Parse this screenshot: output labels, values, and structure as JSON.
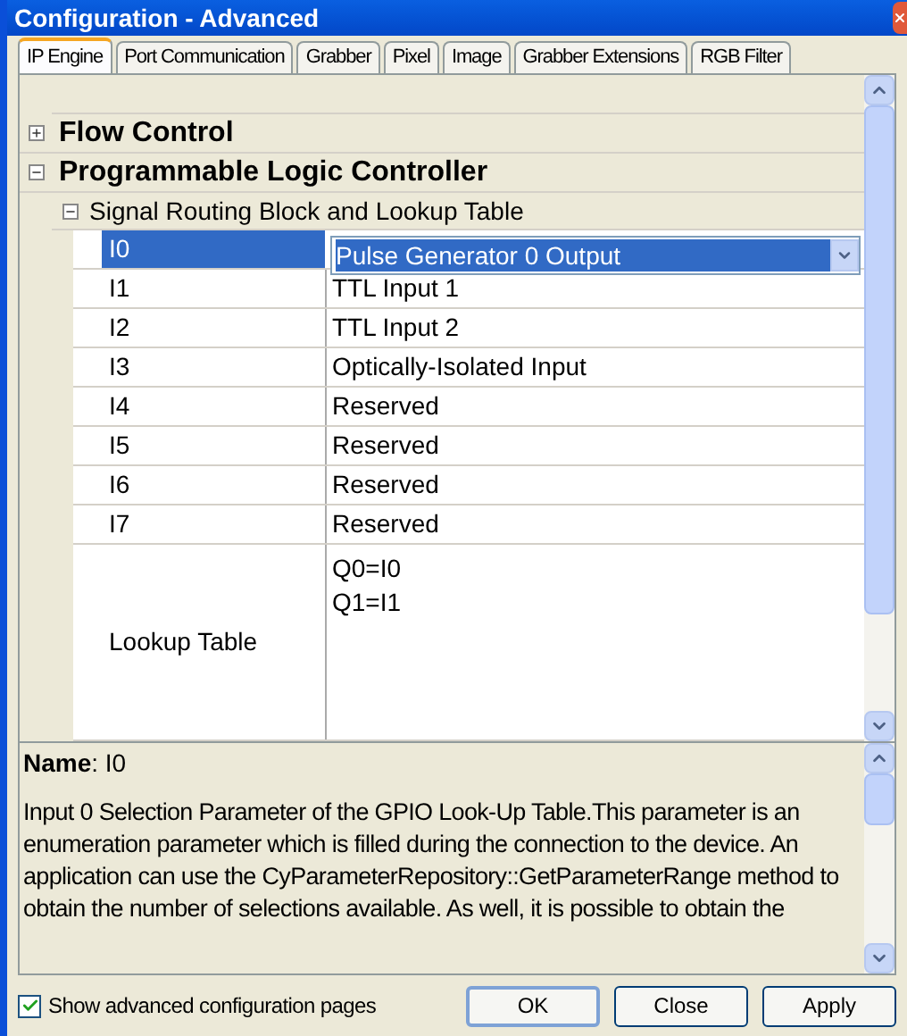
{
  "window": {
    "title": "Configuration - Advanced"
  },
  "tabs": [
    {
      "label": "IP Engine",
      "selected": true
    },
    {
      "label": "Port Communication",
      "selected": false
    },
    {
      "label": "Grabber",
      "selected": false
    },
    {
      "label": "Pixel",
      "selected": false
    },
    {
      "label": "Image",
      "selected": false
    },
    {
      "label": "Grabber Extensions",
      "selected": false
    },
    {
      "label": "RGB Filter",
      "selected": false
    }
  ],
  "grid": {
    "categories": [
      {
        "label": "Flow Control",
        "expanded": false
      },
      {
        "label": "Programmable Logic Controller",
        "expanded": true,
        "children": [
          {
            "label": "Signal Routing Block and Lookup Table",
            "expanded": true,
            "rows": [
              {
                "kind": "dropdown",
                "name": "I0",
                "value": "Pulse Generator 0 Output",
                "selected": true
              },
              {
                "kind": "text",
                "name": "I1",
                "value": "TTL Input 1",
                "selected": false
              },
              {
                "kind": "text",
                "name": "I2",
                "value": "TTL Input 2",
                "selected": false
              },
              {
                "kind": "text",
                "name": "I3",
                "value": "Optically-Isolated Input",
                "selected": false
              },
              {
                "kind": "text",
                "name": "I4",
                "value": "Reserved",
                "selected": false
              },
              {
                "kind": "text",
                "name": "I5",
                "value": "Reserved",
                "selected": false
              },
              {
                "kind": "text",
                "name": "I6",
                "value": "Reserved",
                "selected": false
              },
              {
                "kind": "text",
                "name": "I7",
                "value": "Reserved",
                "selected": false
              },
              {
                "kind": "multiline",
                "name": "Lookup Table",
                "lines": [
                  "Q0=I0",
                  "Q1=I1"
                ],
                "selected": false
              }
            ]
          }
        ]
      }
    ]
  },
  "description": {
    "heading": "**Name**: I0",
    "text": "Input 0 Selection Parameter of the GPIO Look-Up Table.This parameter is an enumeration parameter which is filled during the connection to the device.  An application can use the CyParameterRepository::GetParameterRange method to obtain the number of selections available.  As well, it is possible to obtain the"
  },
  "show_advanced": {
    "label": "Show advanced configuration pages",
    "checked": true
  },
  "buttons": [
    "OK",
    "Close",
    "Apply"
  ]
}
